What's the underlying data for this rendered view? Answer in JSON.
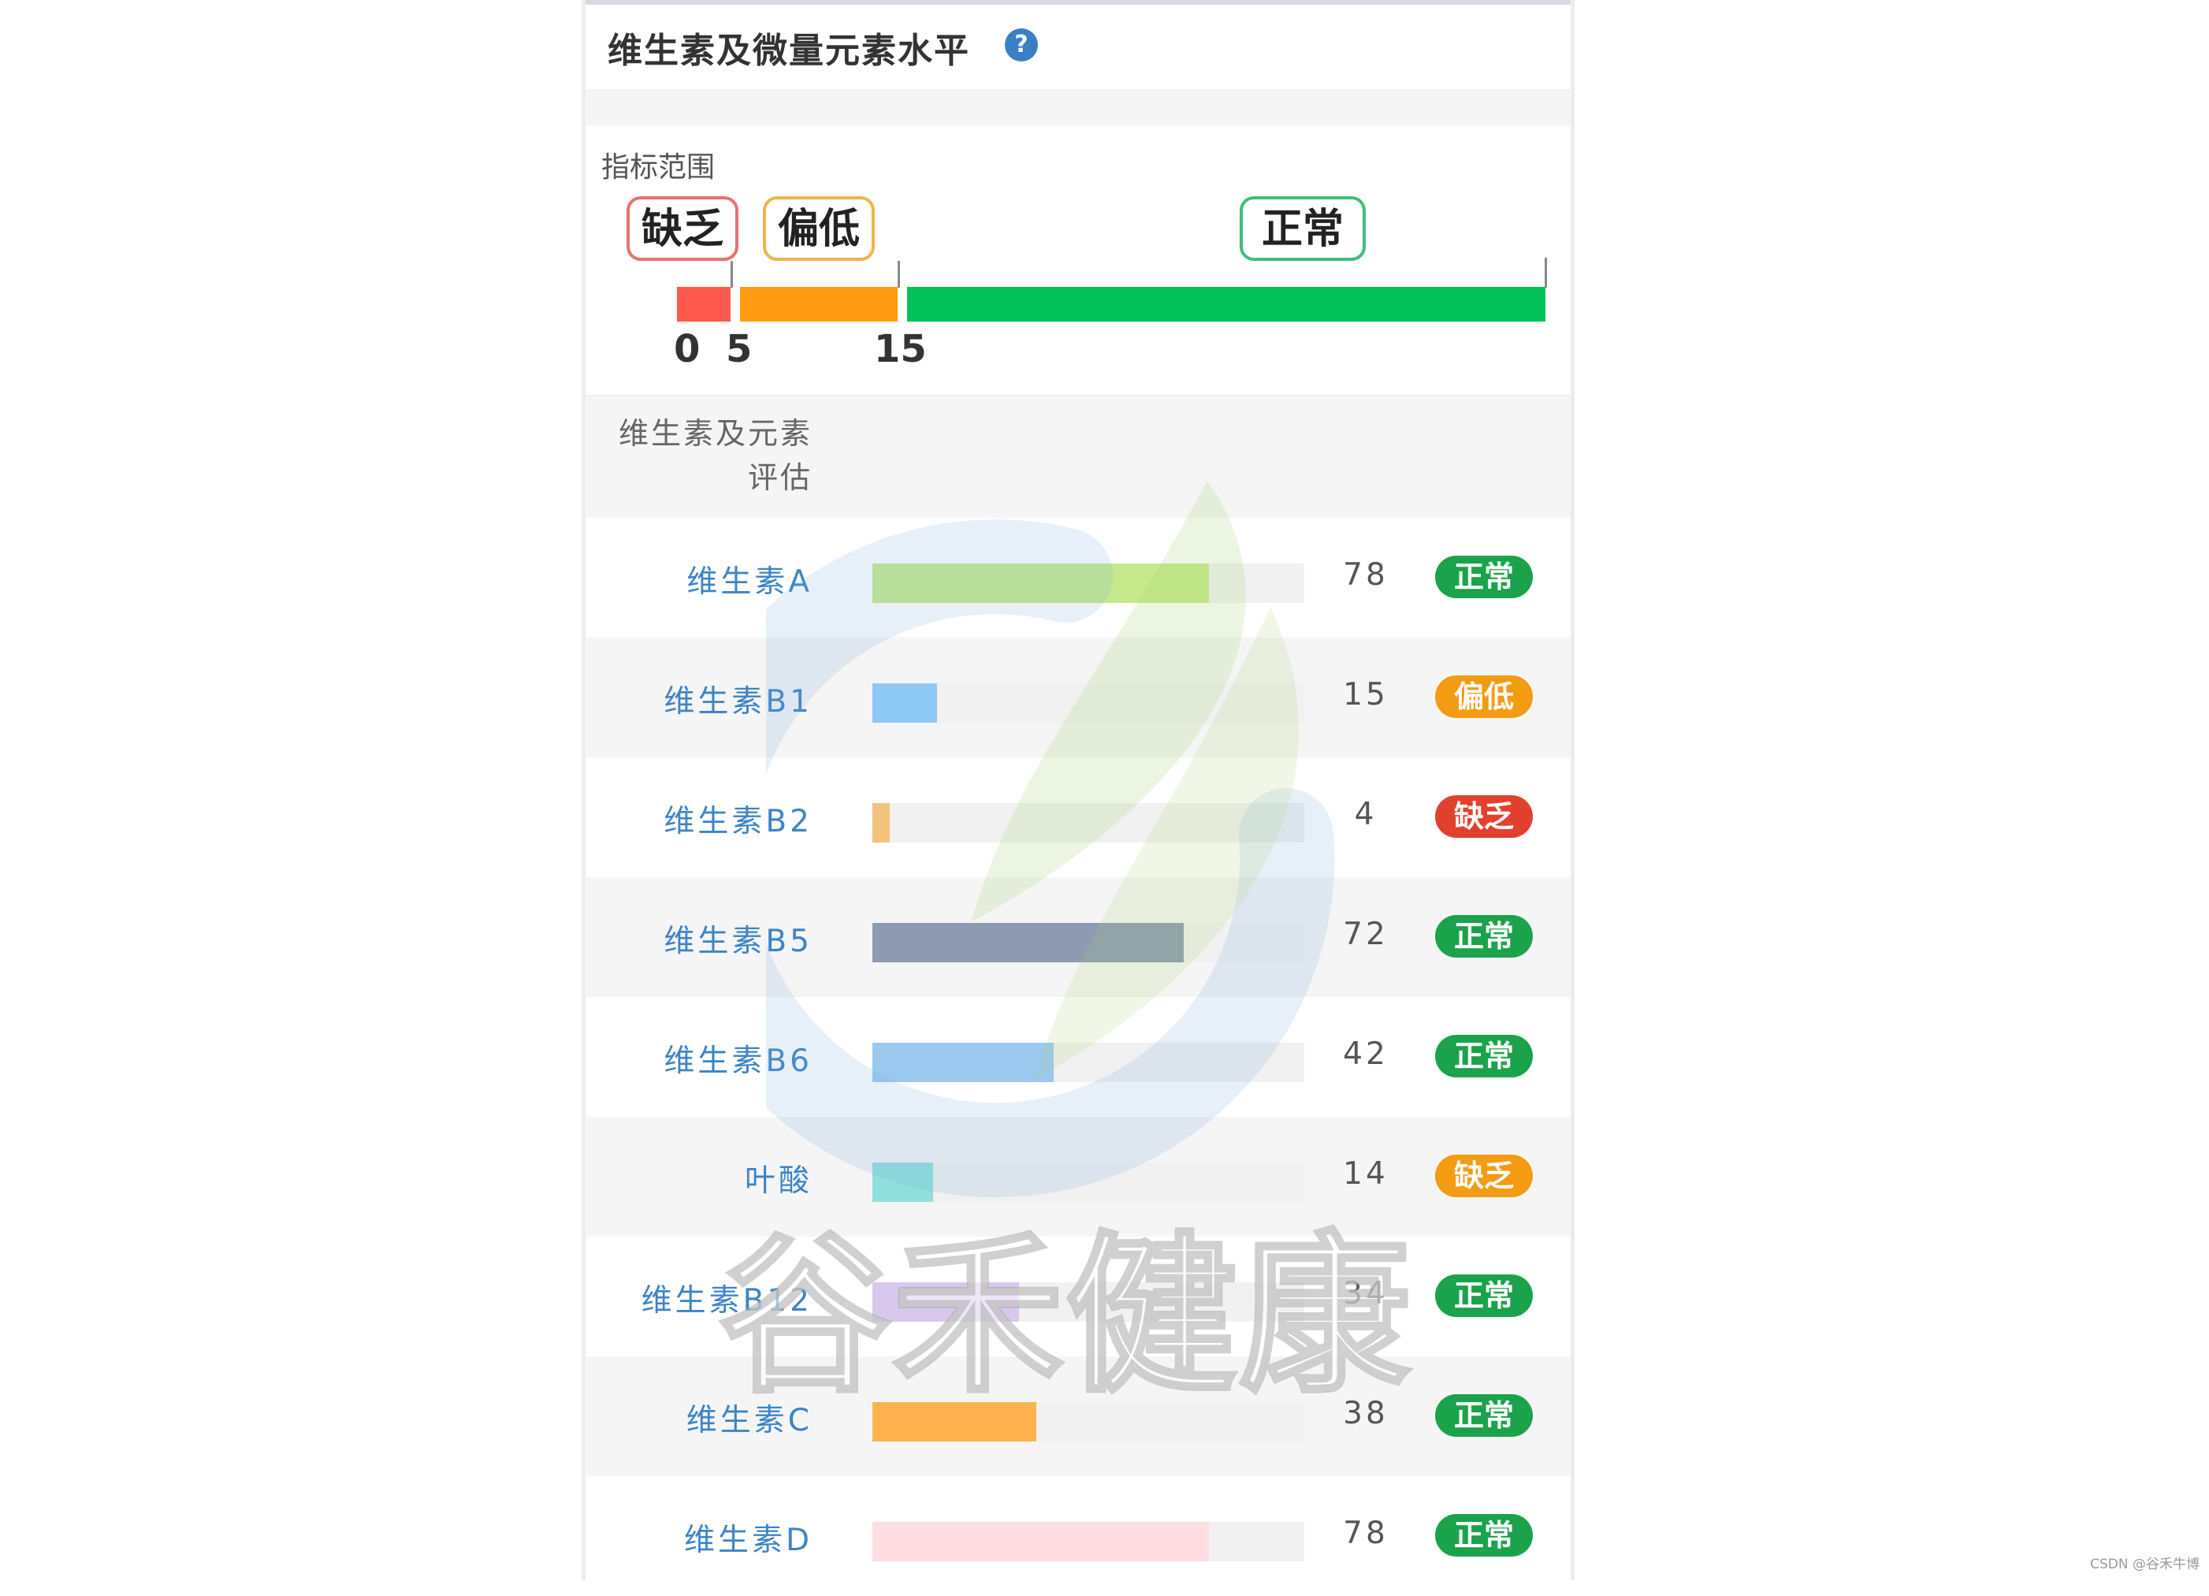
{
  "header": {
    "title": "维生素及微量元素水平",
    "help_icon": "question-circle-icon"
  },
  "range": {
    "label": "指标范围",
    "tags": [
      {
        "label": "缺乏",
        "color": "#e57373"
      },
      {
        "label": "偏低",
        "color": "#f0b44c"
      },
      {
        "label": "正常",
        "color": "#3fbf7a"
      }
    ],
    "segments": [
      {
        "name": "缺乏",
        "from": 0,
        "to": 5,
        "color": "#ff5a4e"
      },
      {
        "name": "偏低",
        "from": 5,
        "to": 15,
        "color": "#ff9c12"
      },
      {
        "name": "正常",
        "from": 15,
        "to": 100,
        "color": "#00c15a"
      }
    ],
    "numbers": [
      "0",
      "5",
      "15"
    ]
  },
  "list": {
    "head_line1": "维生素及元素",
    "head_line2": "评估",
    "items": [
      {
        "label": "维生素A",
        "value": "78",
        "level": 78,
        "bar_color": "#c6e98b",
        "status": "正常",
        "status_color": "#1aa34a"
      },
      {
        "label": "维生素B1",
        "value": "15",
        "level": 15,
        "bar_color": "#8ec8f5",
        "status": "偏低",
        "status_color": "#f39c12"
      },
      {
        "label": "维生素B2",
        "value": "4",
        "level": 4,
        "bar_color": "#f3c27c",
        "status": "缺乏",
        "status_color": "#e2402f"
      },
      {
        "label": "维生素B5",
        "value": "72",
        "level": 72,
        "bar_color": "#8e9ab2",
        "status": "正常",
        "status_color": "#1aa34a"
      },
      {
        "label": "维生素B6",
        "value": "42",
        "level": 42,
        "bar_color": "#9ac8ef",
        "status": "正常",
        "status_color": "#1aa34a"
      },
      {
        "label": "叶酸",
        "value": "14",
        "level": 14,
        "bar_color": "#8fe0dc",
        "status": "缺乏",
        "status_color": "#f39c12"
      },
      {
        "label": "维生素B12",
        "value": "34",
        "level": 34,
        "bar_color": "#d9c8ee",
        "status": "正常",
        "status_color": "#1aa34a"
      },
      {
        "label": "维生素C",
        "value": "38",
        "level": 38,
        "bar_color": "#ffb24d",
        "status": "正常",
        "status_color": "#1aa34a"
      },
      {
        "label": "维生素D",
        "value": "78",
        "level": 78,
        "bar_color": "#ffdde3",
        "status": "正常",
        "status_color": "#1aa34a"
      }
    ]
  },
  "watermark": {
    "text": "谷禾健康",
    "logo": "leaf-swirl-logo-icon"
  },
  "credit": "CSDN @谷禾牛博"
}
